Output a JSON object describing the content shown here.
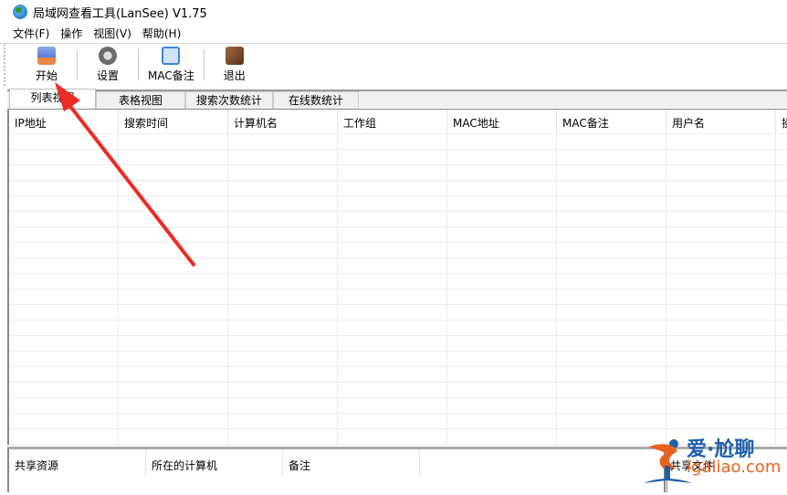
{
  "window": {
    "title": "局域网查看工具(LanSee) V1.75"
  },
  "menu": [
    "文件(F)",
    "操作",
    "视图(V)",
    "帮助(H)"
  ],
  "toolbar": [
    {
      "label": "开始",
      "icon": "start-icon",
      "color": "#5a7fd6"
    },
    {
      "label": "设置",
      "icon": "settings-gear-icon",
      "color": "#6b6b6b"
    },
    {
      "label": "MAC备注",
      "icon": "mac-note-icon",
      "color": "#3f86d8"
    },
    {
      "label": "退出",
      "icon": "exit-boot-icon",
      "color": "#7a4a2a"
    }
  ],
  "tabs": [
    "列表视图",
    "表格视图",
    "搜索次数统计",
    "在线数统计"
  ],
  "active_tab": 0,
  "columns": [
    "IP地址",
    "搜索时间",
    "计算机名",
    "工作组",
    "MAC地址",
    "MAC备注",
    "用户名",
    "操"
  ],
  "bottom_columns": [
    "共享资源",
    "所在的计算机",
    "备注"
  ],
  "bottom_right_column": "共享文件",
  "watermark": {
    "line1": "爱·尬聊",
    "line2": "igaliao.com"
  },
  "annotation_color": "#ee2a24"
}
